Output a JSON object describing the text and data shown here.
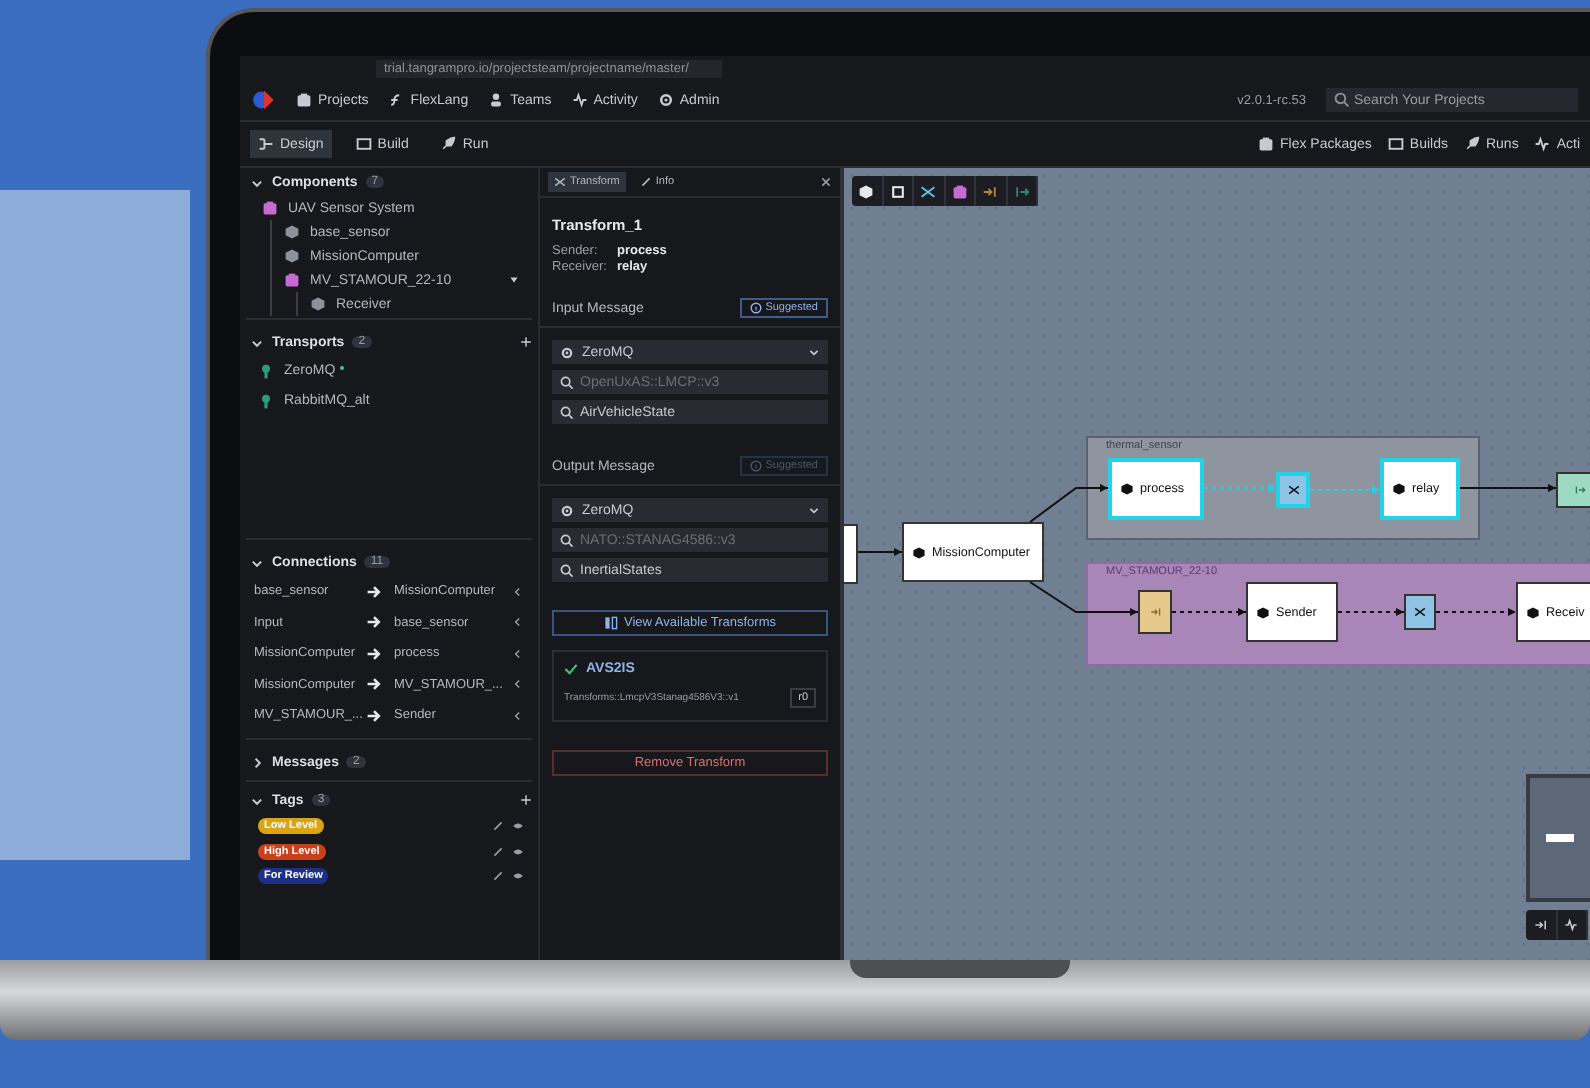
{
  "browser": {
    "url": "trial.tangrampro.io/projectsteam/projectname/master/"
  },
  "nav": {
    "items": [
      {
        "label": "Projects",
        "kind": "projects"
      },
      {
        "label": "FlexLang",
        "kind": "flexlang"
      },
      {
        "label": "Teams",
        "kind": "teams"
      },
      {
        "label": "Activity",
        "kind": "activity"
      },
      {
        "label": "Admin",
        "kind": "admin"
      }
    ],
    "version": "v2.0.1-rc.53",
    "search": {
      "placeholder": "Search Your Projects"
    }
  },
  "mode_tabs": [
    {
      "label": "Design",
      "selected": true
    },
    {
      "label": "Build",
      "selected": false
    },
    {
      "label": "Run",
      "selected": false
    }
  ],
  "toolbar_links": [
    {
      "label": "Flex Packages",
      "kind": "package"
    },
    {
      "label": "Builds",
      "kind": "build"
    },
    {
      "label": "Runs",
      "kind": "run"
    },
    {
      "label": "Acti",
      "kind": "activity"
    }
  ],
  "sidebar": {
    "components": {
      "title": "Components",
      "count": "7",
      "expanded": true,
      "tree": [
        {
          "label": "UAV Sensor System",
          "kind": "system",
          "children": [
            {
              "label": "base_sensor",
              "kind": "component"
            },
            {
              "label": "MissionComputer",
              "kind": "component"
            },
            {
              "label": "MV_STAMOUR_22-10",
              "kind": "system",
              "expanded": true,
              "children": [
                {
                  "label": "Receiver",
                  "kind": "component"
                }
              ]
            }
          ]
        }
      ]
    },
    "transports": {
      "title": "Transports",
      "count": "2",
      "expanded": true,
      "items": [
        {
          "label": "ZeroMQ",
          "modified": true
        },
        {
          "label": "RabbitMQ_alt",
          "modified": false
        }
      ]
    },
    "connections": {
      "title": "Connections",
      "count": "11",
      "expanded": true,
      "rows": [
        {
          "from": "base_sensor",
          "to": "MissionComputer"
        },
        {
          "from": "Input",
          "to": "base_sensor"
        },
        {
          "from": "MissionComputer",
          "to": "process"
        },
        {
          "from": "MissionComputer",
          "to": "MV_STAMOUR_..."
        },
        {
          "from": "MV_STAMOUR_...",
          "to": "Sender"
        }
      ]
    },
    "messages": {
      "title": "Messages",
      "count": "2",
      "expanded": false
    },
    "tags": {
      "title": "Tags",
      "count": "3",
      "expanded": true,
      "items": [
        {
          "label": "Low Level",
          "color": "#d9a514"
        },
        {
          "label": "High Level",
          "color": "#c9411b"
        },
        {
          "label": "For Review",
          "color": "#1d2f86"
        }
      ]
    }
  },
  "transform_panel": {
    "tabs": [
      {
        "label": "Transform",
        "selected": true
      },
      {
        "label": "Info",
        "selected": false
      }
    ],
    "title": "Transform_1",
    "sender_label": "Sender:",
    "sender": "process",
    "receiver_label": "Receiver:",
    "receiver": "relay",
    "input": {
      "heading": "Input Message",
      "button": "Suggested",
      "button_enabled": true,
      "transport": "ZeroMQ",
      "namespace_placeholder": "OpenUxAS::LMCP::v3",
      "message": "AirVehicleState"
    },
    "output": {
      "heading": "Output Message",
      "button": "Suggested",
      "button_enabled": false,
      "transport": "ZeroMQ",
      "namespace_placeholder": "NATO::STANAG4586::v3",
      "message": "InertialStates"
    },
    "view_button": "View Available Transforms",
    "result": {
      "name": "AVS2IS",
      "transform": "Transforms::LmcpV3Stanag4586V3::v1",
      "version": "r0"
    },
    "remove_button": "Remove Transform"
  },
  "canvas": {
    "groups": [
      {
        "label": "thermal_sensor",
        "kind": "subsystem"
      },
      {
        "label": "MV_STAMOUR_22-10",
        "kind": "system"
      }
    ],
    "nodes": [
      {
        "kind": "component",
        "label": "MissionComputer",
        "selected": false
      },
      {
        "kind": "component",
        "label": "process",
        "selected": true
      },
      {
        "kind": "transform",
        "selected": true
      },
      {
        "kind": "component",
        "label": "relay",
        "selected": true
      },
      {
        "kind": "output",
        "selected": false
      },
      {
        "kind": "input",
        "selected": false
      },
      {
        "kind": "component",
        "label": "Sender",
        "selected": false
      },
      {
        "kind": "transform",
        "selected": false
      },
      {
        "kind": "component",
        "label": "Receiv",
        "selected": false
      }
    ]
  }
}
